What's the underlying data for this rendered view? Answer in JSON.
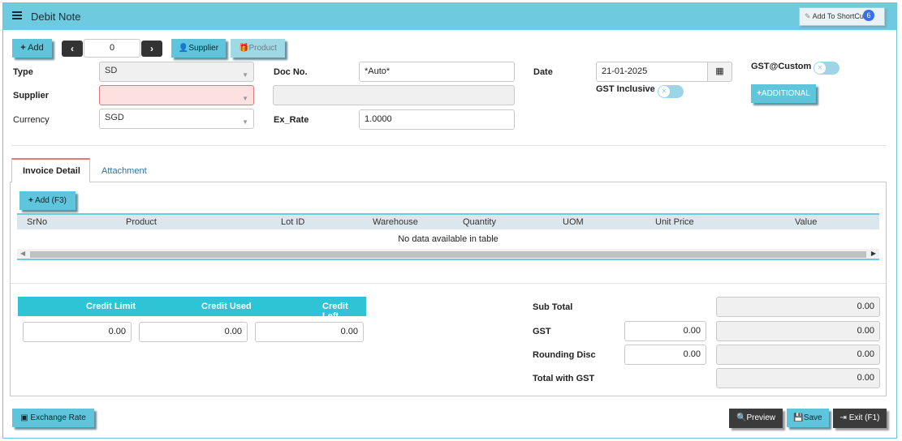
{
  "window": {
    "title": "Debit Note",
    "shortcut_label": "Add To ShortCut",
    "shortcut_count": "6"
  },
  "toolbar": {
    "add_label": "Add",
    "record_value": "0",
    "supplier_label": "Supplier",
    "product_label": "Product"
  },
  "form": {
    "type_label": "Type",
    "type_value": "SD",
    "supplier_label": "Supplier",
    "supplier_value": "",
    "currency_label": "Currency",
    "currency_value": "SGD",
    "docno_label": "Doc No.",
    "docno_value": "*Auto*",
    "exrate_label": "Ex_Rate",
    "exrate_value": "1.0000",
    "date_label": "Date",
    "date_value": "21-01-2025",
    "gst_inclusive_label": "GST Inclusive",
    "gst_custom_label": "GST@Custom",
    "additional_label": "ADDITIONAL"
  },
  "tabs": {
    "invoice_detail": "Invoice Detail",
    "attachment": "Attachment"
  },
  "grid": {
    "add_label": "Add (F3)",
    "columns": [
      "SrNo",
      "Product",
      "Lot ID",
      "Warehouse",
      "Quantity",
      "UOM",
      "Unit Price",
      "Value"
    ],
    "empty_text": "No data available in table"
  },
  "credit": {
    "headers": [
      "Credit Limit",
      "Credit Used",
      "Credit Left"
    ],
    "values": [
      "0.00",
      "0.00",
      "0.00"
    ]
  },
  "totals": {
    "subtotal_label": "Sub Total",
    "subtotal_value": "0.00",
    "gst_label": "GST",
    "gst_rate": "0.00",
    "gst_value": "0.00",
    "rounding_label": "Rounding Disc",
    "rounding_input": "0.00",
    "rounding_value": "0.00",
    "total_label": "Total with GST",
    "total_value": "0.00"
  },
  "footer": {
    "exchange_label": "Exchange Rate",
    "preview_label": "Preview",
    "save_label": "Save",
    "exit_label": "Exit (F1)"
  }
}
